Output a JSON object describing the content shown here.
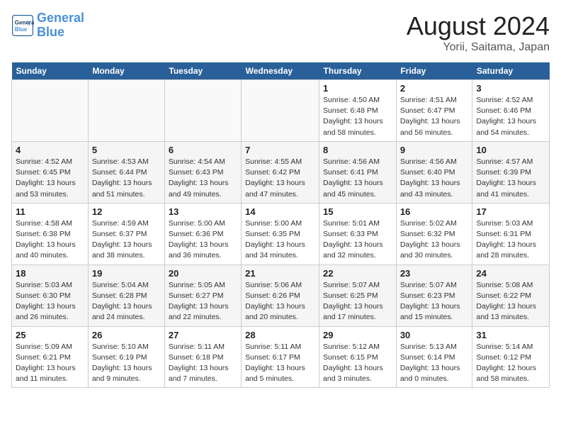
{
  "header": {
    "logo_line1": "General",
    "logo_line2": "Blue",
    "month": "August 2024",
    "location": "Yorii, Saitama, Japan"
  },
  "weekdays": [
    "Sunday",
    "Monday",
    "Tuesday",
    "Wednesday",
    "Thursday",
    "Friday",
    "Saturday"
  ],
  "weeks": [
    [
      {
        "day": "",
        "detail": ""
      },
      {
        "day": "",
        "detail": ""
      },
      {
        "day": "",
        "detail": ""
      },
      {
        "day": "",
        "detail": ""
      },
      {
        "day": "1",
        "detail": "Sunrise: 4:50 AM\nSunset: 6:48 PM\nDaylight: 13 hours\nand 58 minutes."
      },
      {
        "day": "2",
        "detail": "Sunrise: 4:51 AM\nSunset: 6:47 PM\nDaylight: 13 hours\nand 56 minutes."
      },
      {
        "day": "3",
        "detail": "Sunrise: 4:52 AM\nSunset: 6:46 PM\nDaylight: 13 hours\nand 54 minutes."
      }
    ],
    [
      {
        "day": "4",
        "detail": "Sunrise: 4:52 AM\nSunset: 6:45 PM\nDaylight: 13 hours\nand 53 minutes."
      },
      {
        "day": "5",
        "detail": "Sunrise: 4:53 AM\nSunset: 6:44 PM\nDaylight: 13 hours\nand 51 minutes."
      },
      {
        "day": "6",
        "detail": "Sunrise: 4:54 AM\nSunset: 6:43 PM\nDaylight: 13 hours\nand 49 minutes."
      },
      {
        "day": "7",
        "detail": "Sunrise: 4:55 AM\nSunset: 6:42 PM\nDaylight: 13 hours\nand 47 minutes."
      },
      {
        "day": "8",
        "detail": "Sunrise: 4:56 AM\nSunset: 6:41 PM\nDaylight: 13 hours\nand 45 minutes."
      },
      {
        "day": "9",
        "detail": "Sunrise: 4:56 AM\nSunset: 6:40 PM\nDaylight: 13 hours\nand 43 minutes."
      },
      {
        "day": "10",
        "detail": "Sunrise: 4:57 AM\nSunset: 6:39 PM\nDaylight: 13 hours\nand 41 minutes."
      }
    ],
    [
      {
        "day": "11",
        "detail": "Sunrise: 4:58 AM\nSunset: 6:38 PM\nDaylight: 13 hours\nand 40 minutes."
      },
      {
        "day": "12",
        "detail": "Sunrise: 4:59 AM\nSunset: 6:37 PM\nDaylight: 13 hours\nand 38 minutes."
      },
      {
        "day": "13",
        "detail": "Sunrise: 5:00 AM\nSunset: 6:36 PM\nDaylight: 13 hours\nand 36 minutes."
      },
      {
        "day": "14",
        "detail": "Sunrise: 5:00 AM\nSunset: 6:35 PM\nDaylight: 13 hours\nand 34 minutes."
      },
      {
        "day": "15",
        "detail": "Sunrise: 5:01 AM\nSunset: 6:33 PM\nDaylight: 13 hours\nand 32 minutes."
      },
      {
        "day": "16",
        "detail": "Sunrise: 5:02 AM\nSunset: 6:32 PM\nDaylight: 13 hours\nand 30 minutes."
      },
      {
        "day": "17",
        "detail": "Sunrise: 5:03 AM\nSunset: 6:31 PM\nDaylight: 13 hours\nand 28 minutes."
      }
    ],
    [
      {
        "day": "18",
        "detail": "Sunrise: 5:03 AM\nSunset: 6:30 PM\nDaylight: 13 hours\nand 26 minutes."
      },
      {
        "day": "19",
        "detail": "Sunrise: 5:04 AM\nSunset: 6:28 PM\nDaylight: 13 hours\nand 24 minutes."
      },
      {
        "day": "20",
        "detail": "Sunrise: 5:05 AM\nSunset: 6:27 PM\nDaylight: 13 hours\nand 22 minutes."
      },
      {
        "day": "21",
        "detail": "Sunrise: 5:06 AM\nSunset: 6:26 PM\nDaylight: 13 hours\nand 20 minutes."
      },
      {
        "day": "22",
        "detail": "Sunrise: 5:07 AM\nSunset: 6:25 PM\nDaylight: 13 hours\nand 17 minutes."
      },
      {
        "day": "23",
        "detail": "Sunrise: 5:07 AM\nSunset: 6:23 PM\nDaylight: 13 hours\nand 15 minutes."
      },
      {
        "day": "24",
        "detail": "Sunrise: 5:08 AM\nSunset: 6:22 PM\nDaylight: 13 hours\nand 13 minutes."
      }
    ],
    [
      {
        "day": "25",
        "detail": "Sunrise: 5:09 AM\nSunset: 6:21 PM\nDaylight: 13 hours\nand 11 minutes."
      },
      {
        "day": "26",
        "detail": "Sunrise: 5:10 AM\nSunset: 6:19 PM\nDaylight: 13 hours\nand 9 minutes."
      },
      {
        "day": "27",
        "detail": "Sunrise: 5:11 AM\nSunset: 6:18 PM\nDaylight: 13 hours\nand 7 minutes."
      },
      {
        "day": "28",
        "detail": "Sunrise: 5:11 AM\nSunset: 6:17 PM\nDaylight: 13 hours\nand 5 minutes."
      },
      {
        "day": "29",
        "detail": "Sunrise: 5:12 AM\nSunset: 6:15 PM\nDaylight: 13 hours\nand 3 minutes."
      },
      {
        "day": "30",
        "detail": "Sunrise: 5:13 AM\nSunset: 6:14 PM\nDaylight: 13 hours\nand 0 minutes."
      },
      {
        "day": "31",
        "detail": "Sunrise: 5:14 AM\nSunset: 6:12 PM\nDaylight: 12 hours\nand 58 minutes."
      }
    ]
  ]
}
